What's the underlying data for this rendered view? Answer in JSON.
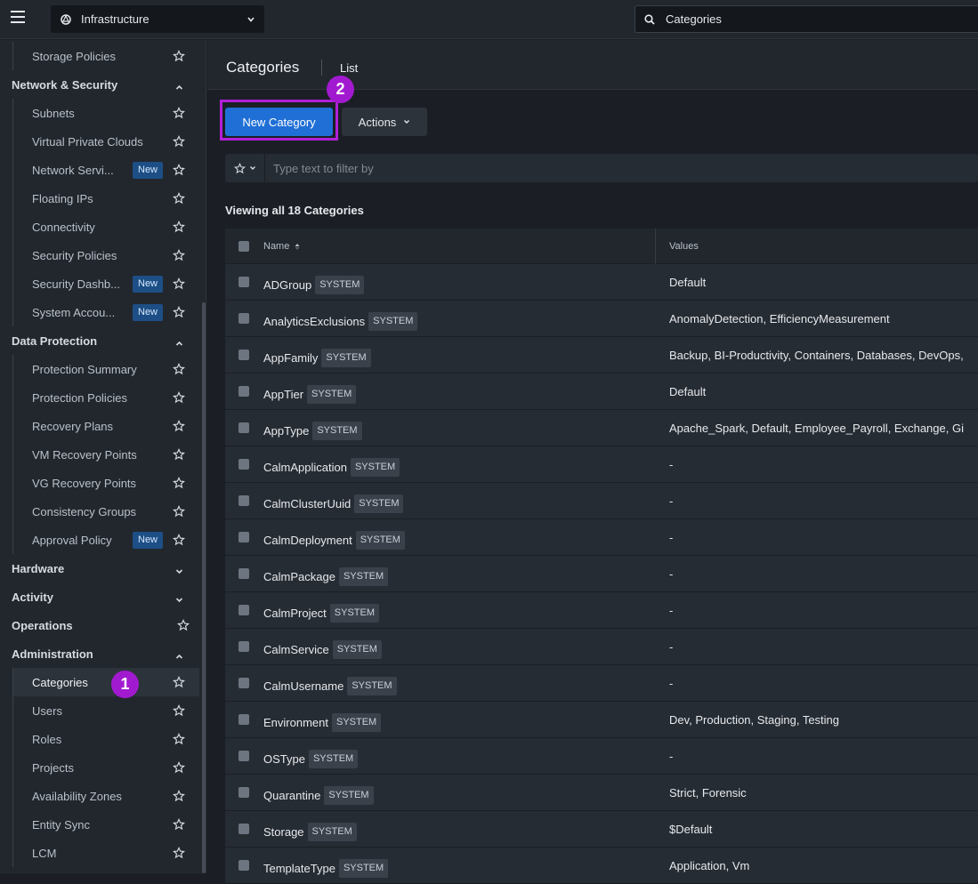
{
  "header": {
    "app_name": "Infrastructure",
    "search_value": "Categories"
  },
  "sidebar": {
    "items": [
      {
        "label": "Storage Policies",
        "type": "item"
      },
      {
        "label": "Network & Security",
        "type": "group",
        "expanded": true
      },
      {
        "label": "Subnets",
        "type": "item"
      },
      {
        "label": "Virtual Private Clouds",
        "type": "item"
      },
      {
        "label": "Network Servi...",
        "type": "item",
        "badge": "New"
      },
      {
        "label": "Floating IPs",
        "type": "item"
      },
      {
        "label": "Connectivity",
        "type": "item"
      },
      {
        "label": "Security Policies",
        "type": "item"
      },
      {
        "label": "Security Dashb...",
        "type": "item",
        "badge": "New",
        "starred": true
      },
      {
        "label": "System Accou...",
        "type": "item",
        "badge": "New"
      },
      {
        "label": "Data Protection",
        "type": "group",
        "expanded": true
      },
      {
        "label": "Protection Summary",
        "type": "item"
      },
      {
        "label": "Protection Policies",
        "type": "item"
      },
      {
        "label": "Recovery Plans",
        "type": "item"
      },
      {
        "label": "VM Recovery Points",
        "type": "item"
      },
      {
        "label": "VG Recovery Points",
        "type": "item"
      },
      {
        "label": "Consistency Groups",
        "type": "item"
      },
      {
        "label": "Approval Policy",
        "type": "item",
        "badge": "New"
      },
      {
        "label": "Hardware",
        "type": "group",
        "expanded": false
      },
      {
        "label": "Activity",
        "type": "group",
        "expanded": false
      },
      {
        "label": "Operations",
        "type": "group-star"
      },
      {
        "label": "Administration",
        "type": "group",
        "expanded": true
      },
      {
        "label": "Categories",
        "type": "item",
        "active": true
      },
      {
        "label": "Users",
        "type": "item"
      },
      {
        "label": "Roles",
        "type": "item"
      },
      {
        "label": "Projects",
        "type": "item"
      },
      {
        "label": "Availability Zones",
        "type": "item"
      },
      {
        "label": "Entity Sync",
        "type": "item"
      },
      {
        "label": "LCM",
        "type": "item"
      }
    ]
  },
  "main": {
    "title": "Categories",
    "view": "List",
    "new_button": "New Category",
    "actions_button": "Actions",
    "filter_placeholder": "Type text to filter by",
    "summary": "Viewing all 18 Categories",
    "steps": {
      "one": "1",
      "two": "2"
    },
    "table": {
      "columns": {
        "name": "Name",
        "values": "Values"
      },
      "tag_label": "SYSTEM",
      "rows": [
        {
          "name": "ADGroup",
          "values": "Default"
        },
        {
          "name": "AnalyticsExclusions",
          "values": "AnomalyDetection, EfficiencyMeasurement"
        },
        {
          "name": "AppFamily",
          "values": "Backup, BI-Productivity, Containers, Databases, DevOps,"
        },
        {
          "name": "AppTier",
          "values": "Default"
        },
        {
          "name": "AppType",
          "values": "Apache_Spark, Default, Employee_Payroll, Exchange, Gi"
        },
        {
          "name": "CalmApplication",
          "values": "-"
        },
        {
          "name": "CalmClusterUuid",
          "values": "-"
        },
        {
          "name": "CalmDeployment",
          "values": "-"
        },
        {
          "name": "CalmPackage",
          "values": "-"
        },
        {
          "name": "CalmProject",
          "values": "-"
        },
        {
          "name": "CalmService",
          "values": "-"
        },
        {
          "name": "CalmUsername",
          "values": "-"
        },
        {
          "name": "Environment",
          "values": "Dev, Production, Staging, Testing"
        },
        {
          "name": "OSType",
          "values": "-"
        },
        {
          "name": "Quarantine",
          "values": "Strict, Forensic"
        },
        {
          "name": "Storage",
          "values": "$Default"
        },
        {
          "name": "TemplateType",
          "values": "Application, Vm"
        }
      ]
    }
  },
  "colors": {
    "accent": "#1f6fd6",
    "highlight": "#b020d8",
    "badge_new": "#1d4f86"
  }
}
